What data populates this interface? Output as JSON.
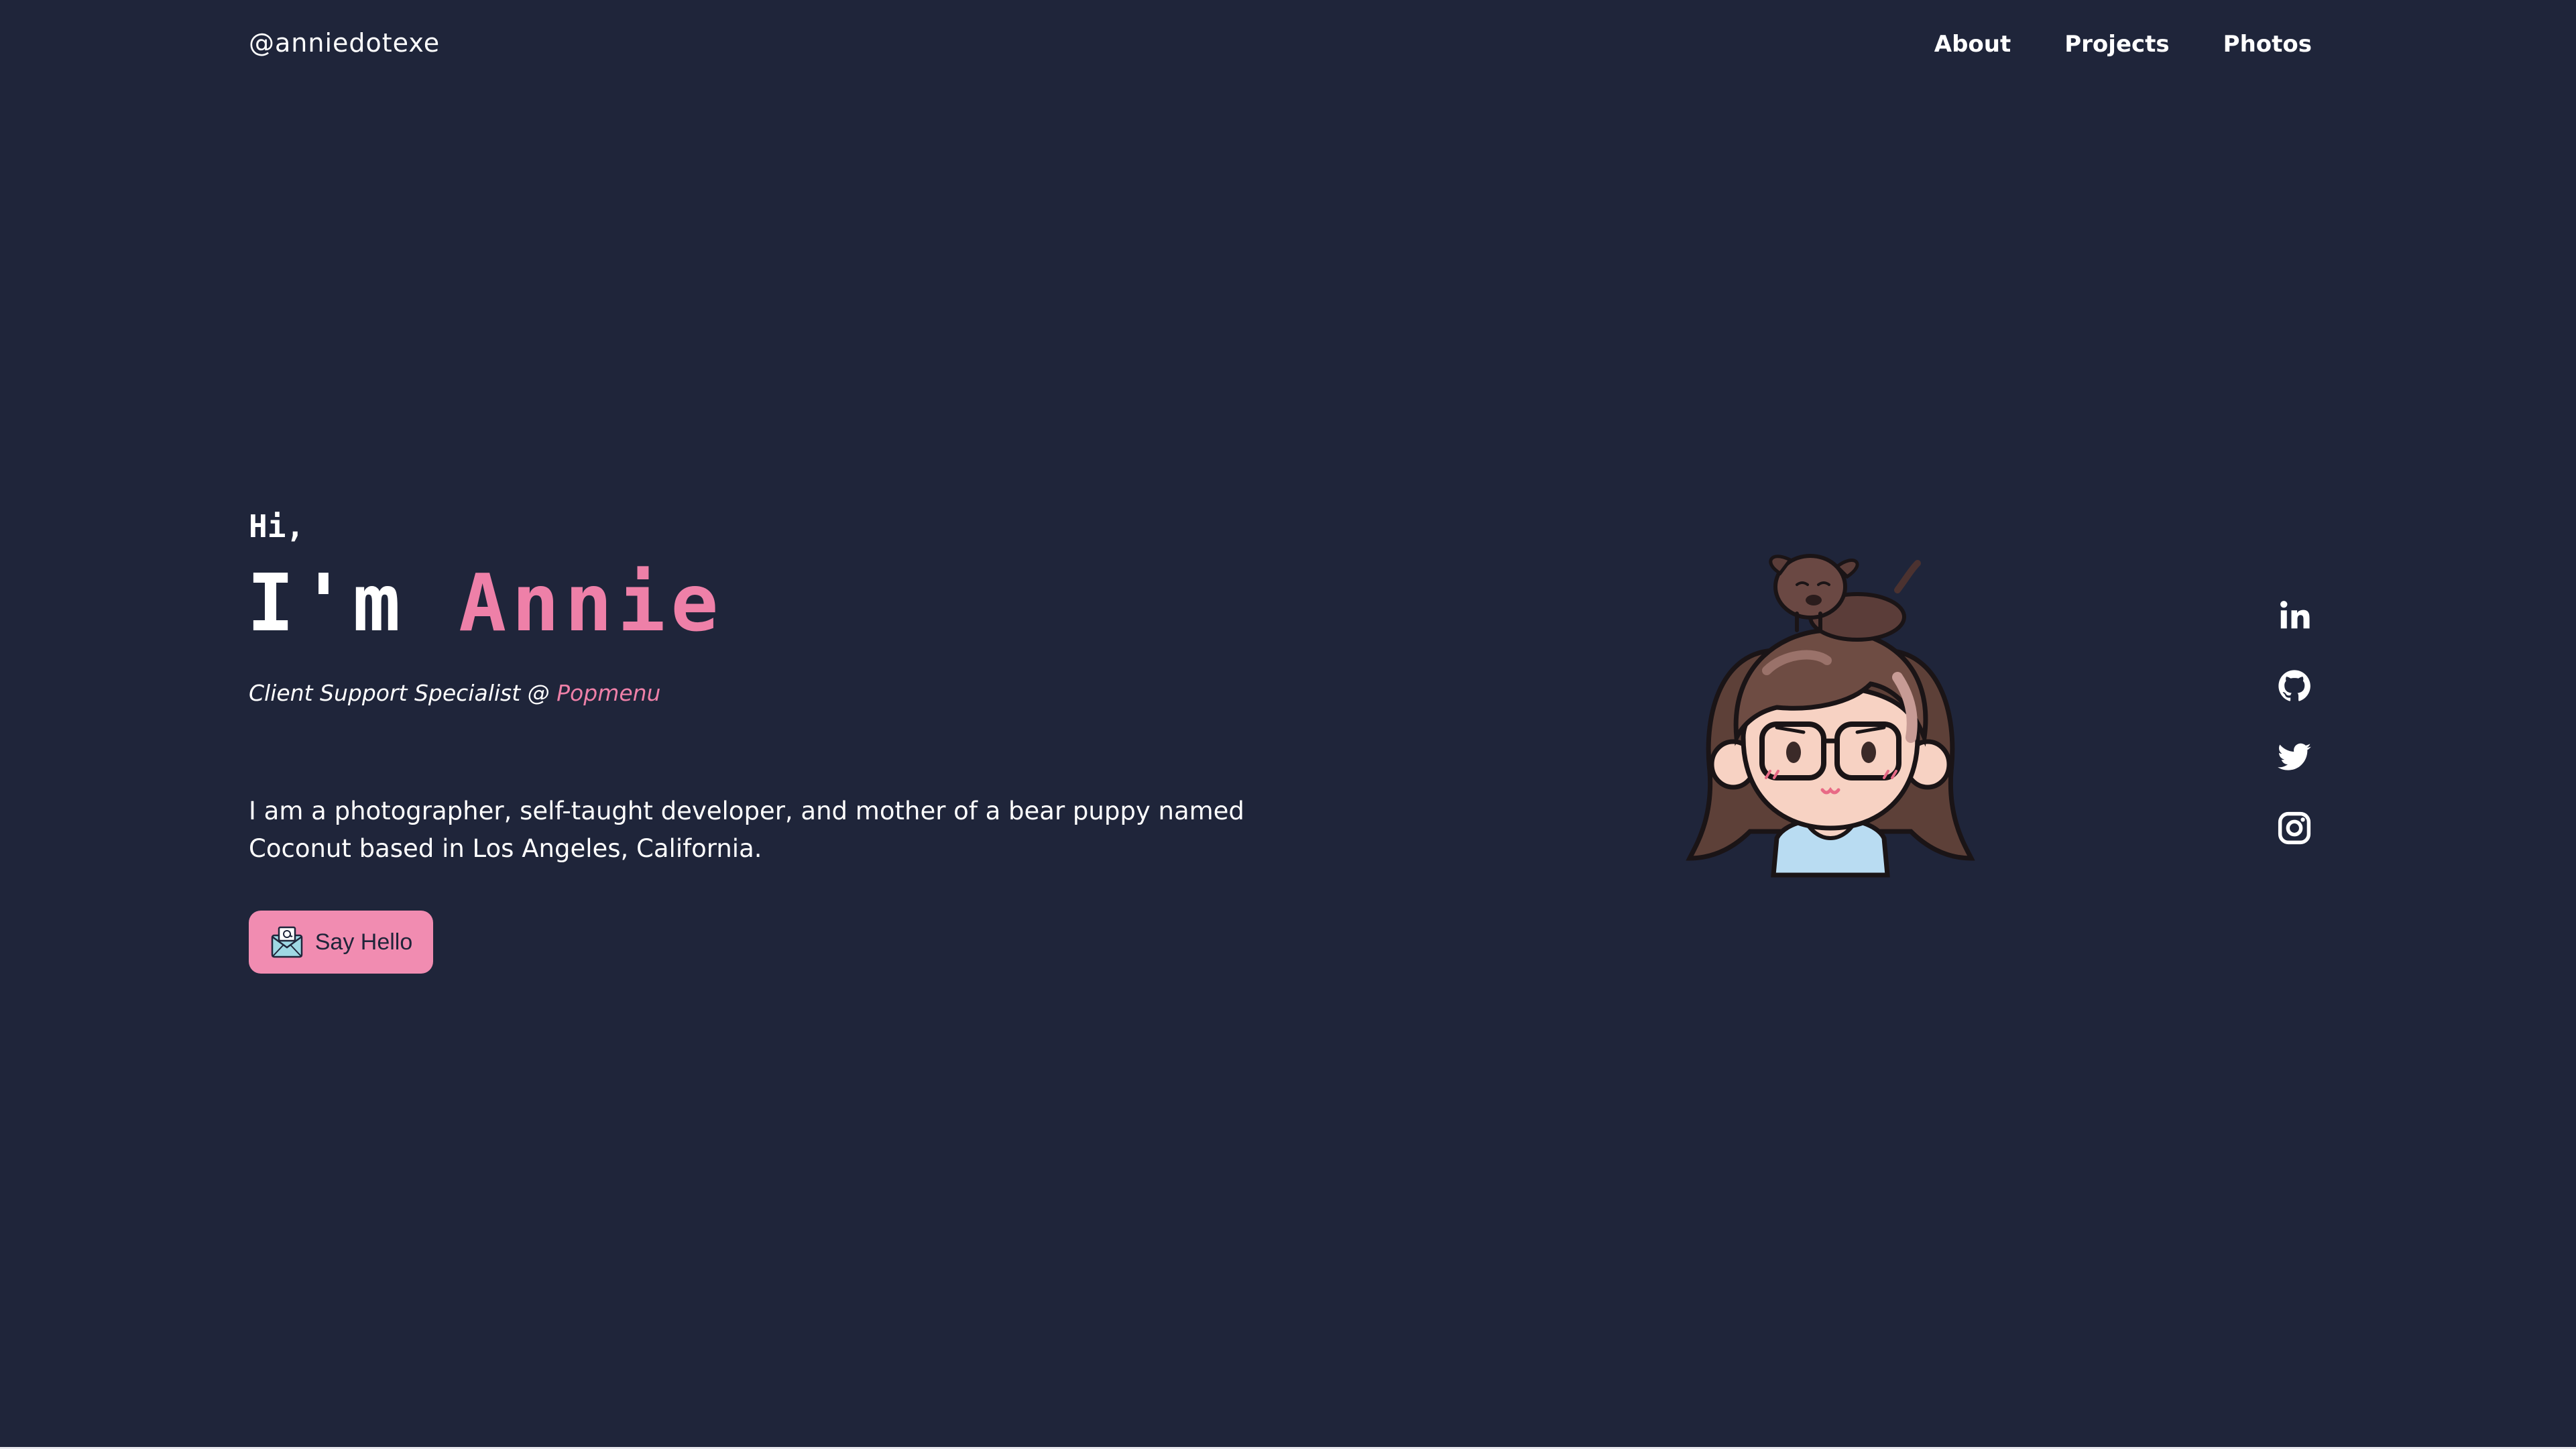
{
  "header": {
    "handle": "@anniedotexe",
    "nav": [
      {
        "label": "About"
      },
      {
        "label": "Projects"
      },
      {
        "label": "Photos"
      }
    ]
  },
  "hero": {
    "greeting": "Hi,",
    "headline_prefix": "I'm ",
    "name": "Annie",
    "role_text": "Client Support Specialist @ ",
    "company": "Popmenu",
    "bio": "I am a photographer, self-taught developer, and mother of a bear puppy named Coconut based in Los Angeles, California.",
    "cta_label": "Say Hello",
    "cta_icon": "envelope-at-icon"
  },
  "avatar": {
    "icon": "cartoon-avatar-with-puppy"
  },
  "socials": [
    {
      "icon": "linkedin-icon"
    },
    {
      "icon": "github-icon"
    },
    {
      "icon": "twitter-icon"
    },
    {
      "icon": "instagram-icon"
    }
  ],
  "colors": {
    "background": "#1f253a",
    "accent": "#ee80a8",
    "button": "#f18cb1",
    "text": "#ffffff"
  }
}
